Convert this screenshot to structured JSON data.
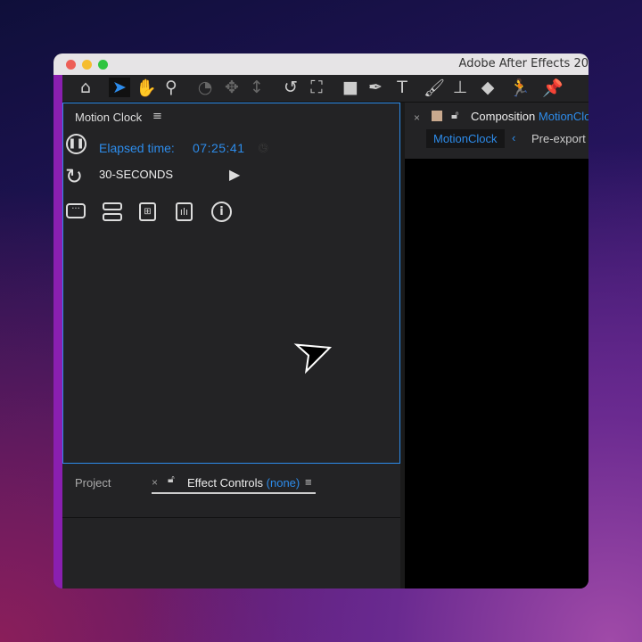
{
  "window": {
    "title": "Adobe After Effects 20"
  },
  "toolbar": {
    "tools": [
      "home-icon",
      "selection-icon",
      "hand-icon",
      "zoom-icon",
      "orbit-icon",
      "pan-icon",
      "dolly-icon",
      "rotate-icon",
      "pan-behind-icon",
      "rectangle-icon",
      "pen-icon",
      "type-icon",
      "brush-icon",
      "clone-stamp-icon",
      "eraser-icon",
      "roto-brush-icon",
      "puppet-pin-icon"
    ]
  },
  "motion_clock": {
    "title": "Motion Clock",
    "elapsed_label": "Elapsed time:",
    "elapsed_value": "07:25:41",
    "interval": "30-SECONDS",
    "accent": "#2d8ceb"
  },
  "composition": {
    "tab_prefix": "Composition",
    "tab_name": "MotionClo",
    "breadcrumb_active": "MotionClock",
    "breadcrumb_next": "Pre-export"
  },
  "bottom": {
    "tab_project": "Project",
    "tab_effect": "Effect Controls",
    "tab_effect_target": "(none)"
  }
}
